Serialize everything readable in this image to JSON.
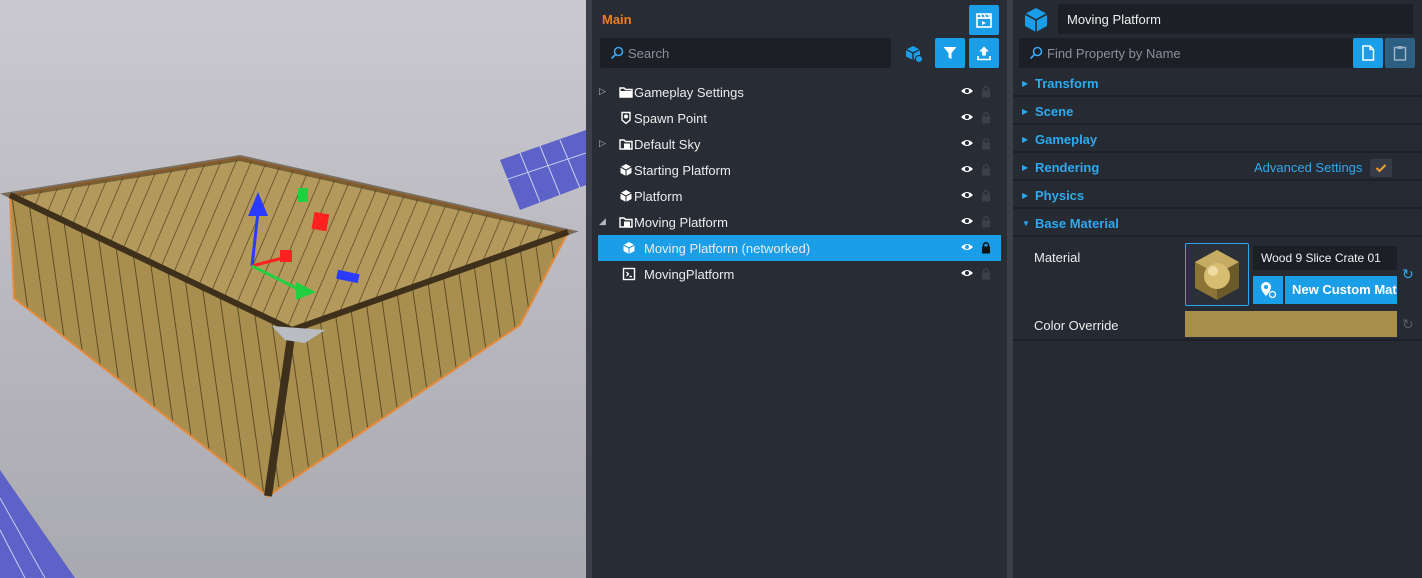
{
  "hierarchy": {
    "title": "Main",
    "search_placeholder": "Search",
    "items": [
      {
        "label": "Gameplay Settings",
        "icon": "folder-icon",
        "expander": "collapsed"
      },
      {
        "label": "Spawn Point",
        "icon": "spawn-point-icon",
        "expander": "none"
      },
      {
        "label": "Default Sky",
        "icon": "template-folder-icon",
        "expander": "collapsed"
      },
      {
        "label": "Starting Platform",
        "icon": "cube-icon",
        "expander": "none"
      },
      {
        "label": "Platform",
        "icon": "cube-icon",
        "expander": "none"
      },
      {
        "label": "Moving Platform",
        "icon": "template-folder-icon",
        "expander": "expanded"
      },
      {
        "label": "Moving Platform (networked)",
        "icon": "networked-cube-icon",
        "expander": "none",
        "selected": true
      },
      {
        "label": "MovingPlatform",
        "icon": "script-icon",
        "expander": "none"
      }
    ]
  },
  "properties": {
    "object_name": "Moving Platform",
    "find_placeholder": "Find Property by Name",
    "sections": [
      {
        "title": "Transform",
        "expanded": false
      },
      {
        "title": "Scene",
        "expanded": false
      },
      {
        "title": "Gameplay",
        "expanded": false
      },
      {
        "title": "Rendering",
        "expanded": false
      },
      {
        "title": "Physics",
        "expanded": false
      },
      {
        "title": "Base Material",
        "expanded": true
      }
    ],
    "advanced_settings_label": "Advanced Settings",
    "advanced_settings_checked": true,
    "material_label": "Material",
    "material_value": "Wood 9 Slice Crate 01",
    "new_custom_material_label": "New Custom Material",
    "color_override_label": "Color Override",
    "color_override_value": "#a78e4b"
  },
  "colors": {
    "accent": "#1a9ee8",
    "title_orange": "#ee7e1b",
    "section_blue": "#2fa9ef"
  }
}
